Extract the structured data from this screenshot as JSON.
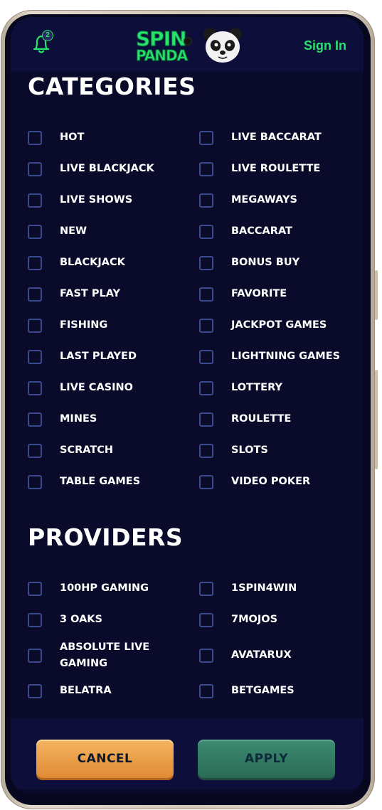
{
  "header": {
    "notification_count": "2",
    "logo_line1": "SPIN",
    "logo_line2": "PANDA",
    "signin_label": "Sign In"
  },
  "categories": {
    "title": "CATEGORIES",
    "left": [
      "HOT",
      "LIVE BLACKJACK",
      "LIVE SHOWS",
      "NEW",
      "BLACKJACK",
      "FAST PLAY",
      "FISHING",
      "LAST PLAYED",
      "LIVE CASINO",
      "MINES",
      "SCRATCH",
      "TABLE GAMES"
    ],
    "right": [
      "LIVE BACCARAT",
      "LIVE ROULETTE",
      "MEGAWAYS",
      "BACCARAT",
      "BONUS BUY",
      "FAVORITE",
      "JACKPOT GAMES",
      "LIGHTNING GAMES",
      "LOTTERY",
      "ROULETTE",
      "SLOTS",
      "VIDEO POKER"
    ]
  },
  "providers": {
    "title": "PROVIDERS",
    "left": [
      "100HP GAMING",
      "3 OAKS",
      "ABSOLUTE LIVE GAMING",
      "BELATRA"
    ],
    "right": [
      "1SPIN4WIN",
      "7MOJOS",
      "AVATARUX",
      "BETGAMES"
    ]
  },
  "footer": {
    "cancel_label": "CANCEL",
    "apply_label": "APPLY"
  },
  "colors": {
    "accent": "#27e36d",
    "background": "#0a0a2b",
    "cancel": "#e99a45",
    "apply": "#347a63"
  }
}
